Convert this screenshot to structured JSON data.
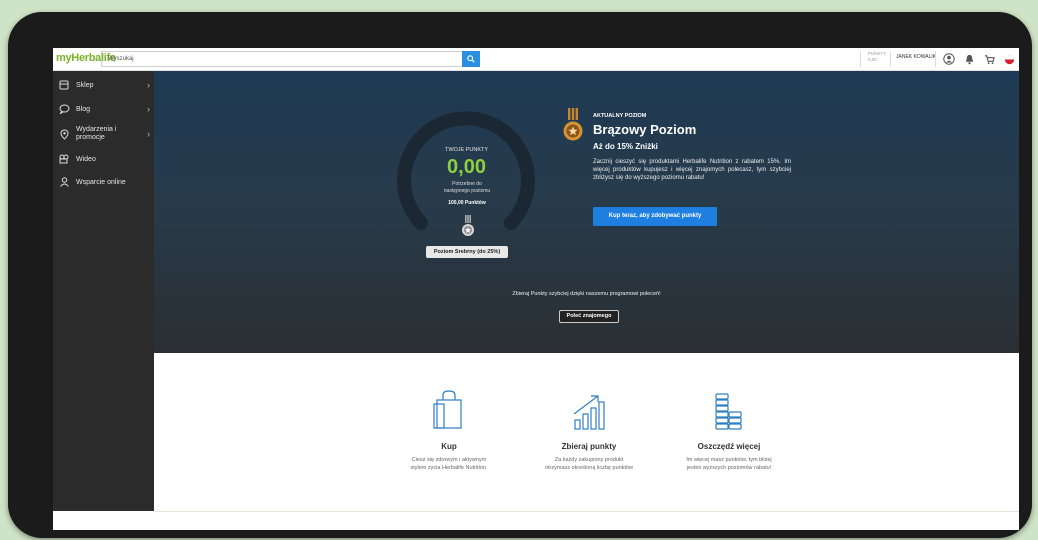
{
  "header": {
    "logo_text": "myHerbalife",
    "search_placeholder": "Wyszukaj",
    "points_label": "PUNKTY",
    "points_value": "0,00",
    "user_name": "JANEK KOWALIK"
  },
  "sidebar": {
    "items": [
      {
        "label": "Sklep",
        "icon": "shop-icon",
        "has_chevron": true
      },
      {
        "label": "Blog",
        "icon": "chat-icon",
        "has_chevron": true
      },
      {
        "label": "Wydarzenia i promocje",
        "icon": "location-icon",
        "has_chevron": true
      },
      {
        "label": "Wideo",
        "icon": "video-icon",
        "has_chevron": false
      },
      {
        "label": "Wsparcie online",
        "icon": "support-icon",
        "has_chevron": false
      }
    ]
  },
  "gauge": {
    "title": "TWOJE PUNKTY",
    "value": "0,00",
    "need_line1": "Potrzebne do",
    "need_line2": "następnego poziomu",
    "points_needed": "100,00 Punktów",
    "next_level_button": "Poziom Srebrny (do 25%)",
    "progress_fraction": 0
  },
  "level": {
    "label": "AKTUALNY POZIOM",
    "title": "Brązowy Poziom",
    "discount": "Aż do 15% Zniżki",
    "description": "Zacznij cieszyć się produktami Herbalife Nutrition z rabatem 15%. Im więcej produktów kupujesz i więcej znajomych polecasz, tym szybciej zbliżysz się do wyższego poziomu rabatu!",
    "cta": "Kup teraz, aby zdobywać punkty"
  },
  "referral": {
    "text": "Zbieraj Punkty szybciej dzięki naszemu programowi poleceń!",
    "button": "Poleć znajomego"
  },
  "features": [
    {
      "title": "Kup",
      "desc1": "Ciesz się zdrowym i aktywnym",
      "desc2": "stylem życia Herbalife Nutrition.",
      "icon": "shopping-bag-icon"
    },
    {
      "title": "Zbieraj punkty",
      "desc1": "Za każdy zakupiony produkt",
      "desc2": "otrzymasz określoną liczbę punktów",
      "icon": "growth-chart-icon"
    },
    {
      "title": "Oszczędź więcej",
      "desc1": "Im więcej masz punktów, tym bliżej",
      "desc2": "jesteś wyższych poziomów rabatu!",
      "icon": "coins-stack-icon"
    }
  ],
  "colors": {
    "brand_green": "#7bb229",
    "accent_blue": "#1f7fe0",
    "bronze": "#c8862a",
    "points_green": "#8ecf3f"
  }
}
